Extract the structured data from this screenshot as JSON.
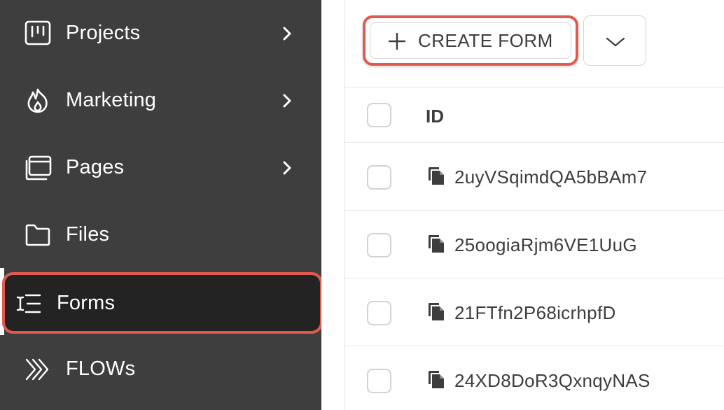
{
  "sidebar": {
    "items": [
      {
        "label": "Projects",
        "icon": "kanban-board-icon",
        "has_submenu": true
      },
      {
        "label": "Marketing",
        "icon": "flame-icon",
        "has_submenu": true
      },
      {
        "label": "Pages",
        "icon": "browser-pages-icon",
        "has_submenu": true
      },
      {
        "label": "Files",
        "icon": "folder-icon",
        "has_submenu": false
      },
      {
        "label": "Forms",
        "icon": "text-cursor-list-icon",
        "has_submenu": false,
        "active": true
      },
      {
        "label": "FLOWs",
        "icon": "triple-chevron-icon",
        "has_submenu": false
      }
    ]
  },
  "toolbar": {
    "create_label": "CREATE FORM"
  },
  "table": {
    "header": {
      "id_label": "ID"
    },
    "rows": [
      {
        "id": "2uyVSqimdQA5bBAm7"
      },
      {
        "id": "25oogiaRjm6VE1UuG"
      },
      {
        "id": "21FTfn2P68icrhpfD"
      },
      {
        "id": "24XD8DoR3QxnqyNAS"
      }
    ]
  },
  "colors": {
    "sidebar_bg": "#3e3e3e",
    "active_item_bg": "#232323",
    "highlight_ring": "#e15a4f",
    "text_dark": "#3d3d3d"
  }
}
